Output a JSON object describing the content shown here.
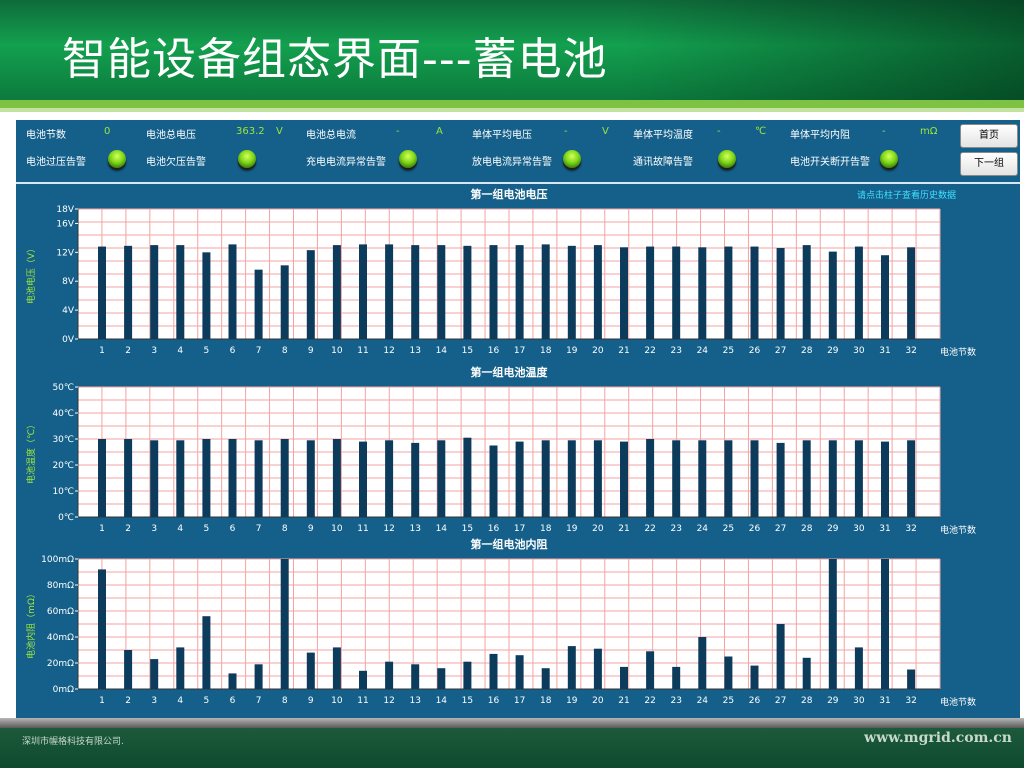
{
  "header": {
    "title": "智能设备组态界面---蓄电池"
  },
  "stats": [
    {
      "label": "电池节数",
      "value": "0",
      "unit": ""
    },
    {
      "label": "电池总电压",
      "value": "363.2",
      "unit": "V"
    },
    {
      "label": "电池总电流",
      "value": "-",
      "unit": "A"
    },
    {
      "label": "单体平均电压",
      "value": "-",
      "unit": "V"
    },
    {
      "label": "单体平均温度",
      "value": "-",
      "unit": "℃"
    },
    {
      "label": "单体平均内阻",
      "value": "-",
      "unit": "mΩ"
    }
  ],
  "alarms": [
    {
      "label": "电池过压告警"
    },
    {
      "label": "电池欠压告警"
    },
    {
      "label": "充电电流异常告警"
    },
    {
      "label": "放电电流异常告警"
    },
    {
      "label": "通讯故障告警"
    },
    {
      "label": "电池开关断开告警"
    }
  ],
  "buttons": {
    "home": "首页",
    "next": "下一组"
  },
  "hint": "请点击柱子查看历史数据",
  "colors": {
    "header": "#13a04f",
    "panel": "#15608a",
    "bar": "#0d3b5c",
    "grid": "#f08080",
    "lamp": "#7cd618",
    "value": "#9be63a"
  },
  "chart_data": [
    {
      "type": "bar",
      "title": "第一组电池电压",
      "ylabel": "电池电压（V）",
      "xlabel": "电池节数",
      "yticks": [
        "0V",
        "4V",
        "8V",
        "12V",
        "16V",
        "18V"
      ],
      "ylim": [
        0,
        18
      ],
      "categories": [
        "1",
        "2",
        "3",
        "4",
        "5",
        "6",
        "7",
        "8",
        "9",
        "10",
        "11",
        "12",
        "13",
        "14",
        "15",
        "16",
        "17",
        "18",
        "19",
        "20",
        "21",
        "22",
        "23",
        "24",
        "25",
        "26",
        "27",
        "28",
        "29",
        "30",
        "31",
        "32"
      ],
      "values": [
        12.8,
        12.9,
        13.0,
        13.0,
        12.0,
        13.1,
        9.6,
        10.2,
        12.3,
        13.0,
        13.1,
        13.1,
        13.0,
        13.0,
        12.9,
        13.0,
        13.0,
        13.1,
        12.9,
        13.0,
        12.7,
        12.8,
        12.8,
        12.7,
        12.8,
        12.8,
        12.6,
        13.0,
        12.1,
        12.8,
        11.6,
        12.7
      ]
    },
    {
      "type": "bar",
      "title": "第一组电池温度",
      "ylabel": "电池温度（℃）",
      "xlabel": "电池节数",
      "yticks": [
        "0℃",
        "10℃",
        "20℃",
        "30℃",
        "40℃",
        "50℃"
      ],
      "ylim": [
        0,
        50
      ],
      "categories": [
        "1",
        "2",
        "3",
        "4",
        "5",
        "6",
        "7",
        "8",
        "9",
        "10",
        "11",
        "12",
        "13",
        "14",
        "15",
        "16",
        "17",
        "18",
        "19",
        "20",
        "21",
        "22",
        "23",
        "24",
        "25",
        "26",
        "27",
        "28",
        "29",
        "30",
        "31",
        "32"
      ],
      "values": [
        30,
        30,
        29.5,
        29.5,
        30,
        30,
        29.5,
        30,
        29.5,
        30,
        29,
        29.5,
        28.5,
        29.5,
        30.5,
        27.5,
        29,
        29.5,
        29.5,
        29.5,
        29,
        30,
        29.5,
        29.5,
        29.5,
        29.5,
        28.5,
        29.5,
        29.5,
        29.5,
        29,
        29.5
      ]
    },
    {
      "type": "bar",
      "title": "第一组电池内阻",
      "ylabel": "电池内阻（mΩ）",
      "xlabel": "电池节数",
      "yticks": [
        "0mΩ",
        "20mΩ",
        "40mΩ",
        "60mΩ",
        "80mΩ",
        "100mΩ"
      ],
      "ylim": [
        0,
        100
      ],
      "categories": [
        "1",
        "2",
        "3",
        "4",
        "5",
        "6",
        "7",
        "8",
        "9",
        "10",
        "11",
        "12",
        "13",
        "14",
        "15",
        "16",
        "17",
        "18",
        "19",
        "20",
        "21",
        "22",
        "23",
        "24",
        "25",
        "26",
        "27",
        "28",
        "29",
        "30",
        "31",
        "32"
      ],
      "values": [
        92,
        30,
        23,
        32,
        56,
        12,
        19,
        100,
        28,
        32,
        14,
        21,
        19,
        16,
        21,
        27,
        26,
        16,
        33,
        31,
        17,
        29,
        17,
        40,
        25,
        18,
        50,
        24,
        100,
        32,
        100,
        15
      ]
    }
  ],
  "footer": {
    "company": "深圳市幄格科技有限公司.",
    "url": "www.mgrid.com.cn"
  }
}
